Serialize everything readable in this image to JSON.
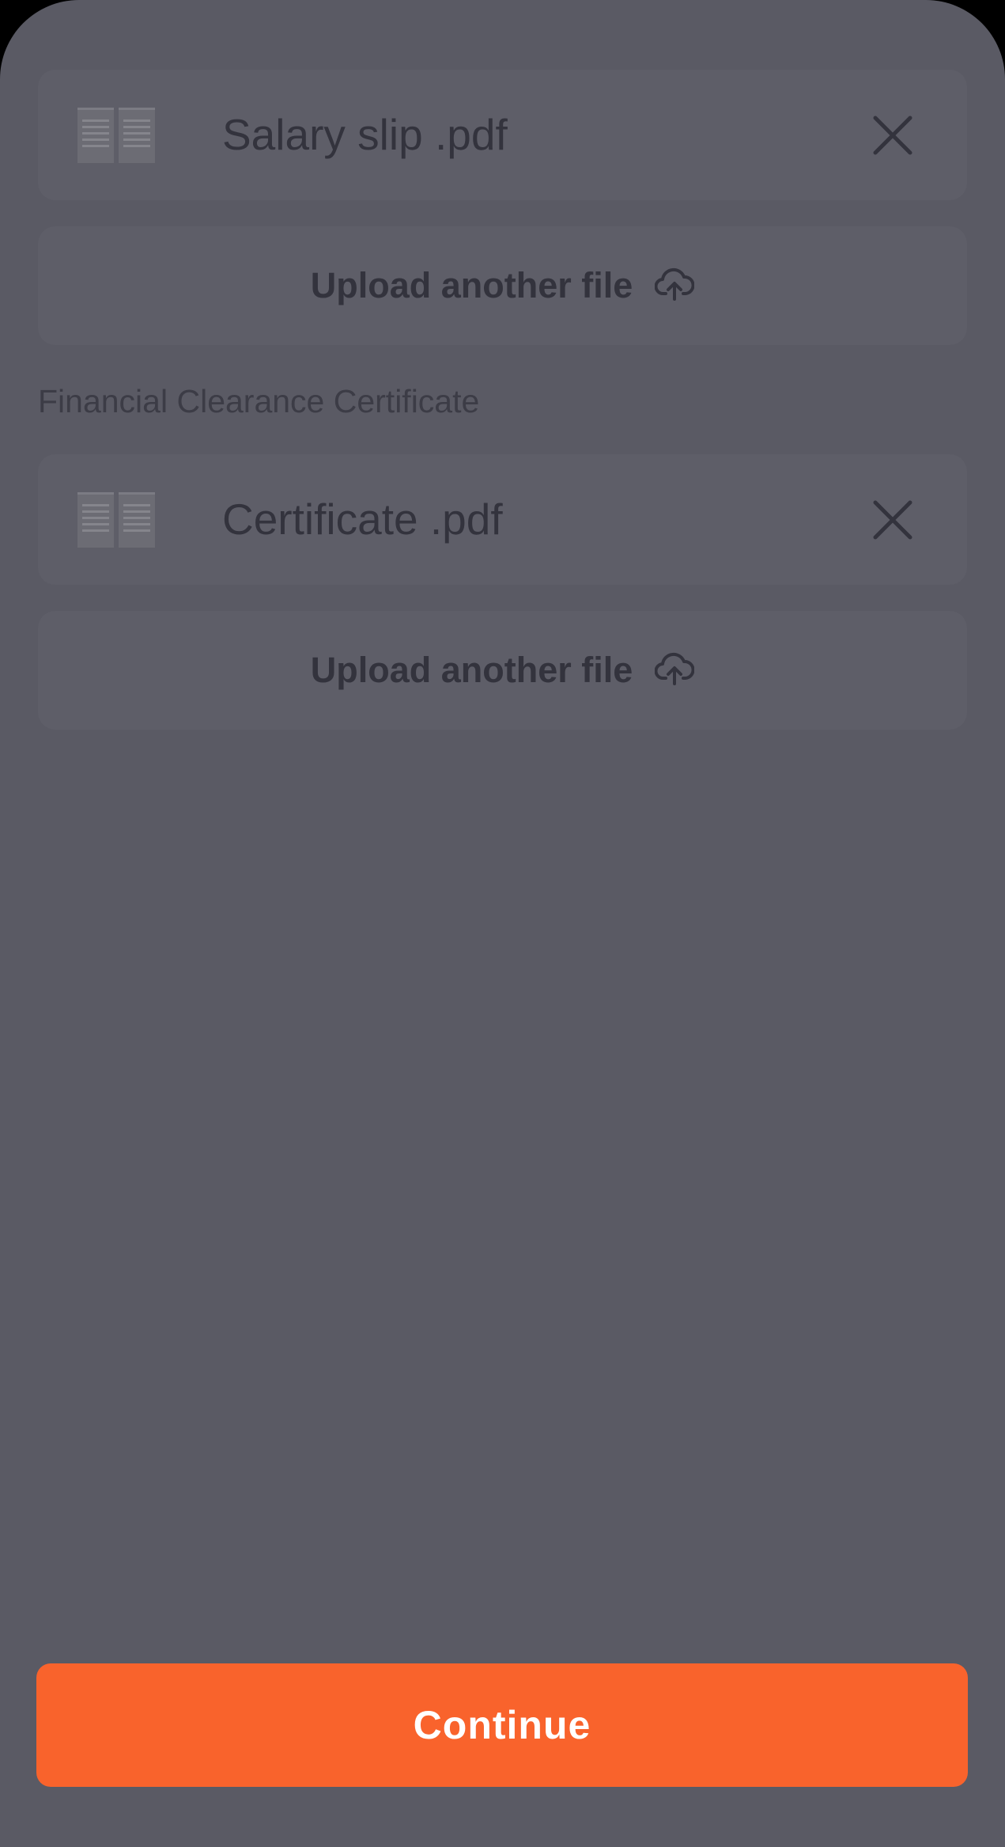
{
  "documents": [
    {
      "section_label": "",
      "file_name": "Salary slip .pdf",
      "upload_label": "Upload another file"
    },
    {
      "section_label": "Financial Clearance Certificate",
      "file_name": "Certificate .pdf",
      "upload_label": "Upload another file"
    }
  ],
  "footer": {
    "continue_label": "Continue"
  },
  "colors": {
    "overlay": "#5a5a64",
    "card": "#5e5e68",
    "text": "#33333d",
    "primary": "#f9632c"
  },
  "icons": {
    "thumbnail": "pdf-thumbnail-icon",
    "remove": "close-icon",
    "upload": "cloud-upload-icon"
  }
}
